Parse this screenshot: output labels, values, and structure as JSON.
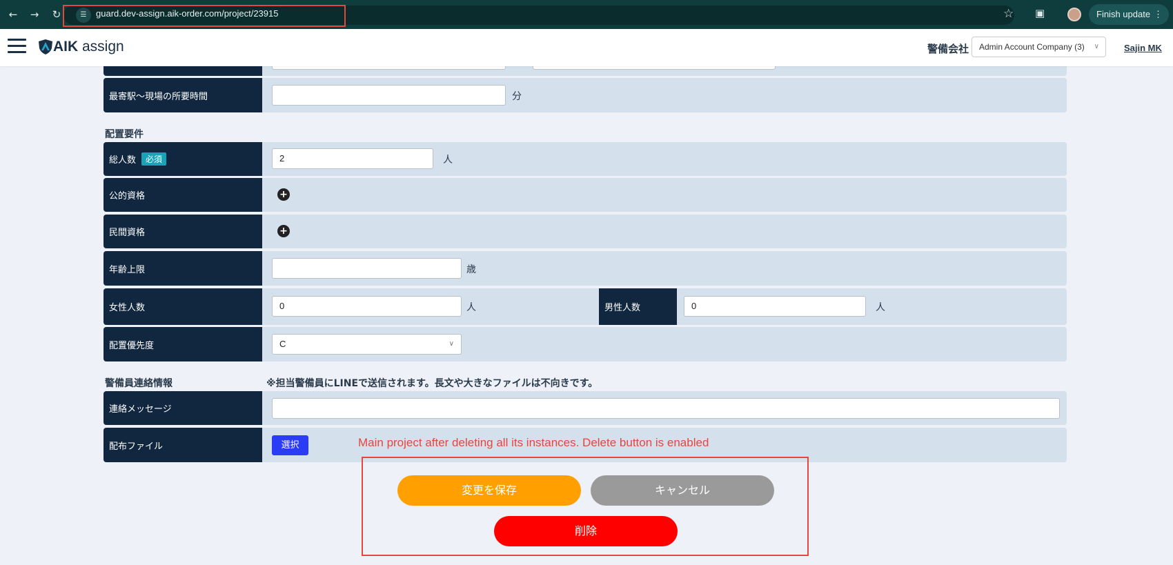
{
  "browser": {
    "url": "guard.dev-assign.aik-order.com/project/23915",
    "update_button": "Finish update",
    "icons": [
      "back-icon",
      "forward-icon",
      "reload-icon",
      "site-info-icon",
      "star-icon",
      "extensions-icon",
      "profile-avatar",
      "more-icon"
    ]
  },
  "header": {
    "logo_text": "AIK assign",
    "company_label": "警備会社",
    "company_select": "Admin Account Company (3)",
    "user_name": "Sajin MK"
  },
  "travel": {
    "travel_time_label": "最寄駅〜現場の所要時間",
    "travel_time_value": "",
    "travel_time_unit": "分"
  },
  "placement": {
    "section_title": "配置要件",
    "total_label": "総人数",
    "required_badge": "必須",
    "total_value": "2",
    "person_unit": "人",
    "public_qual_label": "公的資格",
    "private_qual_label": "民間資格",
    "age_limit_label": "年齢上限",
    "age_limit_value": "",
    "age_unit": "歳",
    "female_label": "女性人数",
    "female_value": "0",
    "male_label": "男性人数",
    "male_value": "0",
    "priority_label": "配置優先度",
    "priority_value": "C"
  },
  "contact": {
    "section_title": "警備員連絡情報",
    "note": "※担当警備員にLINEで送信されます。長文や大きなファイルは不向きです。",
    "message_label": "連絡メッセージ",
    "message_value": "",
    "file_label": "配布ファイル",
    "file_button": "選択"
  },
  "actions": {
    "save": "変更を保存",
    "cancel": "キャンセル",
    "delete": "削除"
  },
  "annotation": {
    "text": "Main project after deleting all its instances. Delete button is enabled",
    "color": "#e8453c"
  },
  "colors": {
    "label_bg": "#10273f",
    "row_bg": "#d4e0eb",
    "save": "#ff9f00",
    "cancel": "#9a9a9a",
    "delete": "#ff0000",
    "select_btn": "#2a3cf5"
  }
}
